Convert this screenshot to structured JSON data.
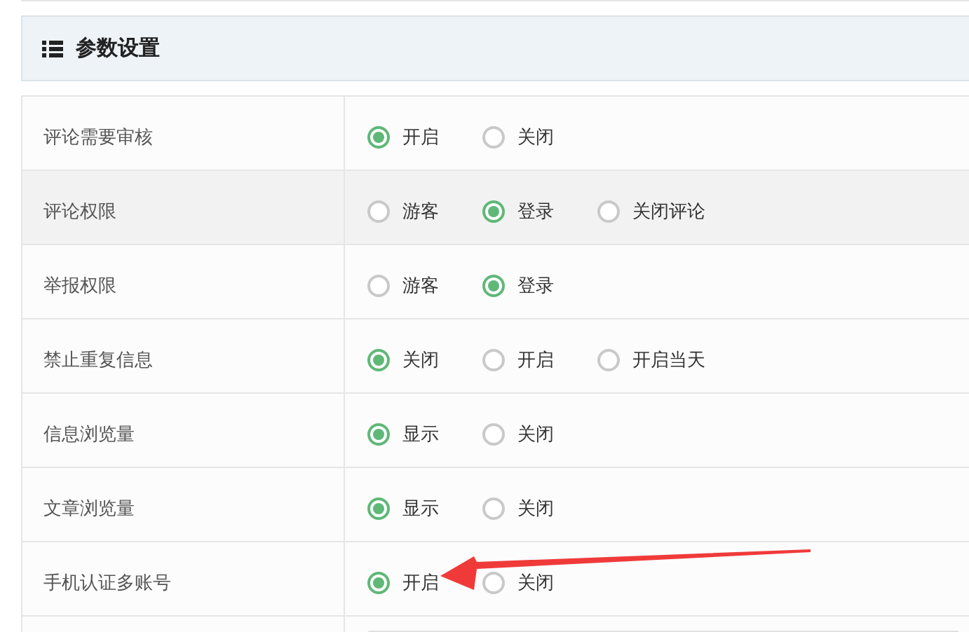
{
  "panel": {
    "title": "参数设置"
  },
  "settings": [
    {
      "label": "评论需要审核",
      "options": [
        {
          "label": "开启",
          "selected": true
        },
        {
          "label": "关闭",
          "selected": false
        }
      ]
    },
    {
      "label": "评论权限",
      "options": [
        {
          "label": "游客",
          "selected": false
        },
        {
          "label": "登录",
          "selected": true
        },
        {
          "label": "关闭评论",
          "selected": false
        }
      ]
    },
    {
      "label": "举报权限",
      "options": [
        {
          "label": "游客",
          "selected": false
        },
        {
          "label": "登录",
          "selected": true
        }
      ]
    },
    {
      "label": "禁止重复信息",
      "options": [
        {
          "label": "关闭",
          "selected": true
        },
        {
          "label": "开启",
          "selected": false
        },
        {
          "label": "开启当天",
          "selected": false
        }
      ]
    },
    {
      "label": "信息浏览量",
      "options": [
        {
          "label": "显示",
          "selected": true
        },
        {
          "label": "关闭",
          "selected": false
        }
      ]
    },
    {
      "label": "文章浏览量",
      "options": [
        {
          "label": "显示",
          "selected": true
        },
        {
          "label": "关闭",
          "selected": false
        }
      ]
    },
    {
      "label": "手机认证多账号",
      "options": [
        {
          "label": "开启",
          "selected": true
        },
        {
          "label": "关闭",
          "selected": false
        }
      ]
    }
  ]
}
